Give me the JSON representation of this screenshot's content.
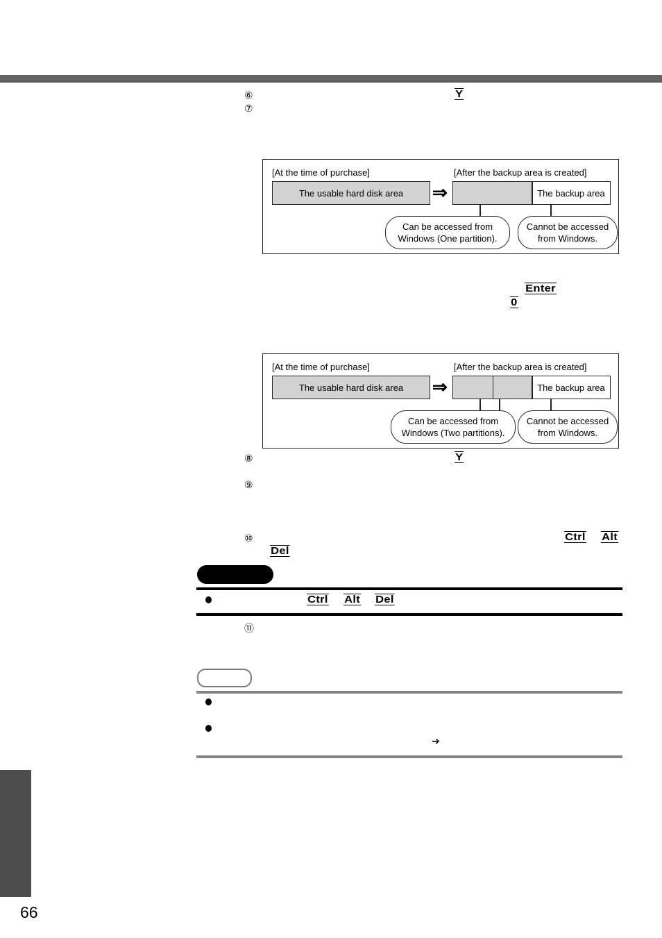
{
  "page": {
    "number": "66",
    "colors": {
      "header_bar": "#636363",
      "side_tab": "#4d4d4d",
      "diagram_fill": "#d3d3d3",
      "note_rule": "#838383"
    }
  },
  "steps": {
    "s6": {
      "marker": "⑥",
      "key": "Y"
    },
    "s7": {
      "marker": "⑦"
    },
    "s8": {
      "marker": "⑧",
      "key": "Y"
    },
    "s9": {
      "marker": "⑨"
    },
    "s10": {
      "marker": "⑩",
      "keys": [
        "Ctrl",
        "Alt",
        "Del"
      ]
    },
    "s11": {
      "marker": "⑪"
    }
  },
  "mid_keys": {
    "enter": "Enter",
    "zero": "0"
  },
  "diagram1": {
    "before_label": "[At the time of purchase]",
    "after_label": "[After the backup area is created]",
    "usable_area": "The usable hard disk area",
    "arrow": "⇒",
    "backup_area": "The backup area",
    "accessible_bubble": [
      "Can be accessed from",
      "Windows (One partition)."
    ],
    "inaccessible_bubble": [
      "Cannot be accessed",
      "from Windows."
    ]
  },
  "diagram2": {
    "before_label": "[At the time of purchase]",
    "after_label": "[After the backup area is created]",
    "usable_area": "The usable hard disk area",
    "arrow": "⇒",
    "backup_area": "The backup area",
    "accessible_bubble": [
      "Can be accessed from",
      "Windows (Two partitions)."
    ],
    "inaccessible_bubble": [
      "Cannot be accessed",
      "from Windows."
    ]
  },
  "caution": {
    "bullet_keys": [
      "Ctrl",
      "Alt",
      "Del"
    ]
  },
  "note": {
    "arrow_glyph": "➔"
  }
}
